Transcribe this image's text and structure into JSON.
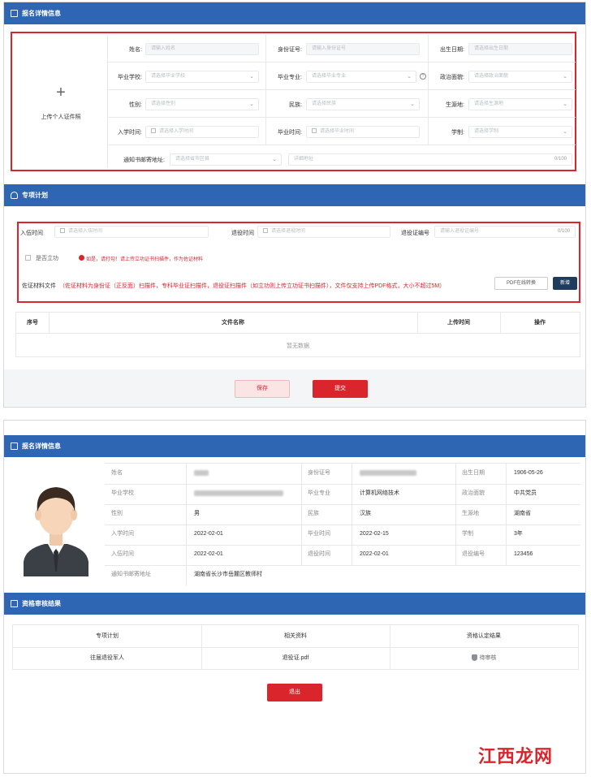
{
  "form": {
    "section1_title": "报名详情信息",
    "upload_plus": "+",
    "upload_label": "上传个人证件照",
    "fields": {
      "name_label": "姓名:",
      "name_ph": "请输入姓名",
      "id_label": "身份证号:",
      "id_ph": "请输入身份证号",
      "birth_label": "出生日期:",
      "birth_ph": "请选择出生日期",
      "school_label": "毕业学校:",
      "school_ph": "请选择毕业学校",
      "major_label": "毕业专业:",
      "major_ph": "请选择毕业专业",
      "political_label": "政治面貌:",
      "political_ph": "请选择政治面貌",
      "gender_label": "性别:",
      "gender_ph": "请选择性别",
      "ethnic_label": "民族:",
      "ethnic_ph": "请选择民族",
      "origin_label": "生源地:",
      "origin_ph": "请选择生源地",
      "enroll_label": "入学时间:",
      "enroll_ph": "请选择入学时间",
      "grad_label": "毕业时间:",
      "grad_ph": "请选择毕业时间",
      "system_label": "学制:",
      "system_ph": "请选择学制",
      "addr_label": "通知书邮寄地址:",
      "addr_region_ph": "请选择省市区县",
      "addr_detail_ph": "详细地址",
      "addr_count": "0/100"
    },
    "section2_title": "专项计划",
    "plan": {
      "enlist_label": "入伍时间",
      "enlist_ph": "请选择入伍时间",
      "retire_label": "退役时间",
      "retire_ph": "请选择退役时间",
      "retire_no_label": "退役证编号",
      "retire_no_ph": "请输入退役证编号",
      "retire_no_count": "0/100",
      "merit_label": "是否立功",
      "merit_note": "如是，请打勾！请上传立功证书扫描件，作为佐证材料",
      "evidence_label": "佐证材料文件",
      "evidence_note": "（佐证材料为身份证（正反面）扫描件，专科毕业证扫描件，退役证扫描件（如立功则上传立功证书扫描件），文件仅支持上传PDF格式，大小不超过5M）",
      "pdf_btn": "PDF在线转换",
      "add_btn": "新增"
    },
    "file_table": {
      "headers": [
        "序号",
        "文件名称",
        "上传时间",
        "操作"
      ],
      "empty": "暂无数据"
    },
    "save_btn": "保存",
    "submit_btn": "提交"
  },
  "detail": {
    "section1_title": "报名详情信息",
    "rows": [
      [
        {
          "k": "姓名",
          "v": ""
        },
        {
          "k": "身份证号",
          "v": ""
        },
        {
          "k": "出生日期",
          "v": "1906-05-26"
        }
      ],
      [
        {
          "k": "毕业学校",
          "v": ""
        },
        {
          "k": "毕业专业",
          "v": "计算机网络技术"
        },
        {
          "k": "政治面貌",
          "v": "中共党员"
        }
      ],
      [
        {
          "k": "性别",
          "v": "男"
        },
        {
          "k": "民族",
          "v": "汉族"
        },
        {
          "k": "生源地",
          "v": "湖南省"
        }
      ],
      [
        {
          "k": "入学时间",
          "v": "2022-02-01"
        },
        {
          "k": "毕业时间",
          "v": "2022-02-15"
        },
        {
          "k": "学制",
          "v": "3年"
        }
      ],
      [
        {
          "k": "入伍时间",
          "v": "2022-02-01"
        },
        {
          "k": "退役时间",
          "v": "2022-02-01"
        },
        {
          "k": "退役编号",
          "v": "123456"
        }
      ]
    ],
    "addr_key": "通知书邮寄地址",
    "addr_val": "湖南省长沙市岳麓区教师村",
    "section2_title": "资格审核结果",
    "result_headers": [
      "专项计划",
      "相关资料",
      "资格认定结果"
    ],
    "result_row": [
      "往届退役军人",
      "退役证.pdf",
      "待审核"
    ],
    "exit_btn": "退出"
  },
  "watermark": "江西龙网",
  "colors": {
    "header_blue": "#2f66b4",
    "accent_red": "#d9252b",
    "dark_btn": "#1f3b5e"
  }
}
